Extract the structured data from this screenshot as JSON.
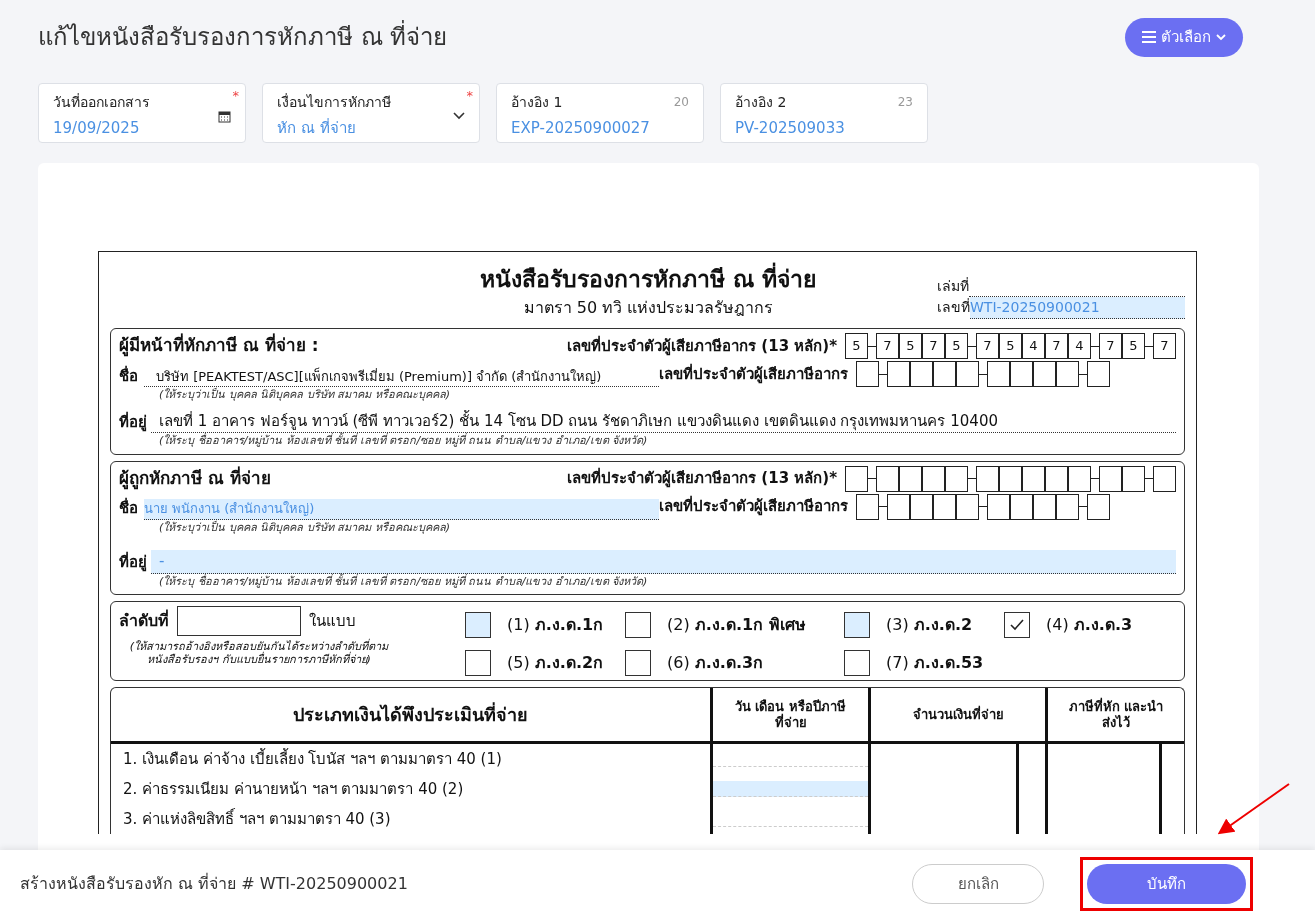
{
  "page_title": "แก้ไขหนังสือรับรองการหักภาษี ณ ที่จ่าย",
  "options_button": {
    "label": "ตัวเลือก"
  },
  "fields": [
    {
      "kind": "date",
      "label": "วันที่ออกเอกสาร",
      "value": "19/09/2025",
      "required_mark": "*"
    },
    {
      "kind": "select",
      "label": "เงื่อนไขการหักภาษี",
      "value": "หัก ณ ที่จ่าย",
      "required_mark": "*"
    },
    {
      "kind": "text",
      "label": "อ้างอิง 1",
      "value": "EXP-20250900027",
      "counter": "20"
    },
    {
      "kind": "text",
      "label": "อ้างอิง 2",
      "value": "PV-202509033",
      "counter": "23"
    }
  ],
  "form": {
    "title": "หนังสือรับรองการหักภาษี ณ ที่จ่าย",
    "subtitle": "มาตรา 50 ทวิ แห่งประมวลรัษฎากร",
    "book_label": "เล่มที่",
    "number_label": "เลขที่",
    "number_value": "WTI-20250900021",
    "parties": [
      {
        "heading": "ผู้มีหน้าที่หักภาษี ณ ที่จ่าย :",
        "tax_id_label": "เลขที่ประจำตัวผู้เสียภาษีอากร (13 หลัก)*",
        "tax_id_digits": [
          "5",
          "7",
          "5",
          "7",
          "5",
          "7",
          "5",
          "4",
          "7",
          "4",
          "7",
          "5",
          "7"
        ],
        "name_label": "ชื่อ",
        "name": "บริษัท [PEAKTEST/ASC][แพ็กเกจพรีเมี่ยม (Premium)] จำกัด (สำนักงานใหญ่)",
        "name_highlighted": false,
        "branch_id_label": "เลขที่ประจำตัวผู้เสียภาษีอากร",
        "name_hint": "(ให้ระบุว่าเป็น บุคคล นิติบุคคล บริษัท สมาคม หรือคณะบุคคล)",
        "address_label": "ที่อยู่",
        "address": "เลขที่ 1 อาคาร ฟอร์จูน ทาวน์ (ซีพี ทาวเวอร์2) ชั้น 14 โซน DD ถนน รัชดาภิเษก แขวงดินแดง เขตดินแดง กรุงเทพมหานคร 10400",
        "address_highlighted": false,
        "address_hint": "(ให้ระบุ ชื่ออาคาร/หมู่บ้าน ห้องเลขที่ ชั้นที่ เลขที่ ตรอก/ซอย หมู่ที่ ถนน ตำบล/แขวง อำเภอ/เขต จังหวัด)"
      },
      {
        "heading": "ผู้ถูกหักภาษี ณ ที่จ่าย",
        "tax_id_label": "เลขที่ประจำตัวผู้เสียภาษีอากร (13 หลัก)*",
        "name_label": "ชื่อ",
        "name": "นาย พนักงาน (สำนักงานใหญ่)",
        "name_highlighted": true,
        "branch_id_label": "เลขที่ประจำตัวผู้เสียภาษีอากร",
        "name_hint": "(ให้ระบุว่าเป็น บุคคล นิติบุคคล บริษัท สมาคม หรือคณะบุคคล)",
        "address_label": "ที่อยู่",
        "address": "-",
        "address_highlighted": true,
        "address_hint": "(ให้ระบุ ชื่ออาคาร/หมู่บ้าน ห้องเลขที่ ชั้นที่ เลขที่ ตรอก/ซอย หมู่ที่ ถนน ตำบล/แขวง อำเภอ/เขต จังหวัด)"
      }
    ],
    "sequence_label": "ลำดับที่",
    "form_label": "ในแบบ",
    "sequence_hint": "(ให้สามารถอ้างอิงหรือสอบยันกันได้ระหว่างลำดับที่ตามหนังสือรับรองฯ กับแบบยื่นรายการภาษีหักที่จ่าย)",
    "form_types": [
      {
        "label": "(1) **ภ.ง.ด.1ก**",
        "checked": false,
        "highlighted": true
      },
      {
        "label": "(2) **ภ.ง.ด.1ก พิเศษ**",
        "checked": false,
        "highlighted": false
      },
      {
        "label": "(3) **ภ.ง.ด.2**",
        "checked": false,
        "highlighted": true
      },
      {
        "label": "(4) **ภ.ง.ด.3**",
        "checked": true,
        "highlighted": false
      },
      {
        "label": "(5) **ภ.ง.ด.2ก**",
        "checked": false,
        "highlighted": false
      },
      {
        "label": "(6) **ภ.ง.ด.3ก**",
        "checked": false,
        "highlighted": false
      },
      {
        "label": "(7) **ภ.ง.ด.53**",
        "checked": false,
        "highlighted": false
      }
    ],
    "income_table": {
      "columns": [
        "ประเภทเงินได้พึงประเมินที่จ่าย",
        "วัน เดือน หรือปีภาษี ที่จ่าย",
        "จำนวนเงินที่จ่าย",
        "ภาษีที่หัก และนำส่งไว้"
      ],
      "rows": [
        {
          "label": "1. เงินเดือน ค่าจ้าง เบี้ยเลี้ยง โบนัส ฯลฯ ตามมาตรา 40 (1)",
          "date_highlighted": false
        },
        {
          "label": "2. ค่าธรรมเนียม ค่านายหน้า ฯลฯ ตามมาตรา 40 (2)",
          "date_highlighted": true
        },
        {
          "label": "3. ค่าแห่งลิขสิทธิ์ ฯลฯ ตามมาตรา 40 (3)",
          "date_highlighted": false
        }
      ]
    }
  },
  "footer": {
    "title": "สร้างหนังสือรับรองหัก ณ ที่จ่าย # WTI-20250900021",
    "cancel_label": "ยกเลิก",
    "save_label": "บันทึก",
    "save_annotated": true
  }
}
